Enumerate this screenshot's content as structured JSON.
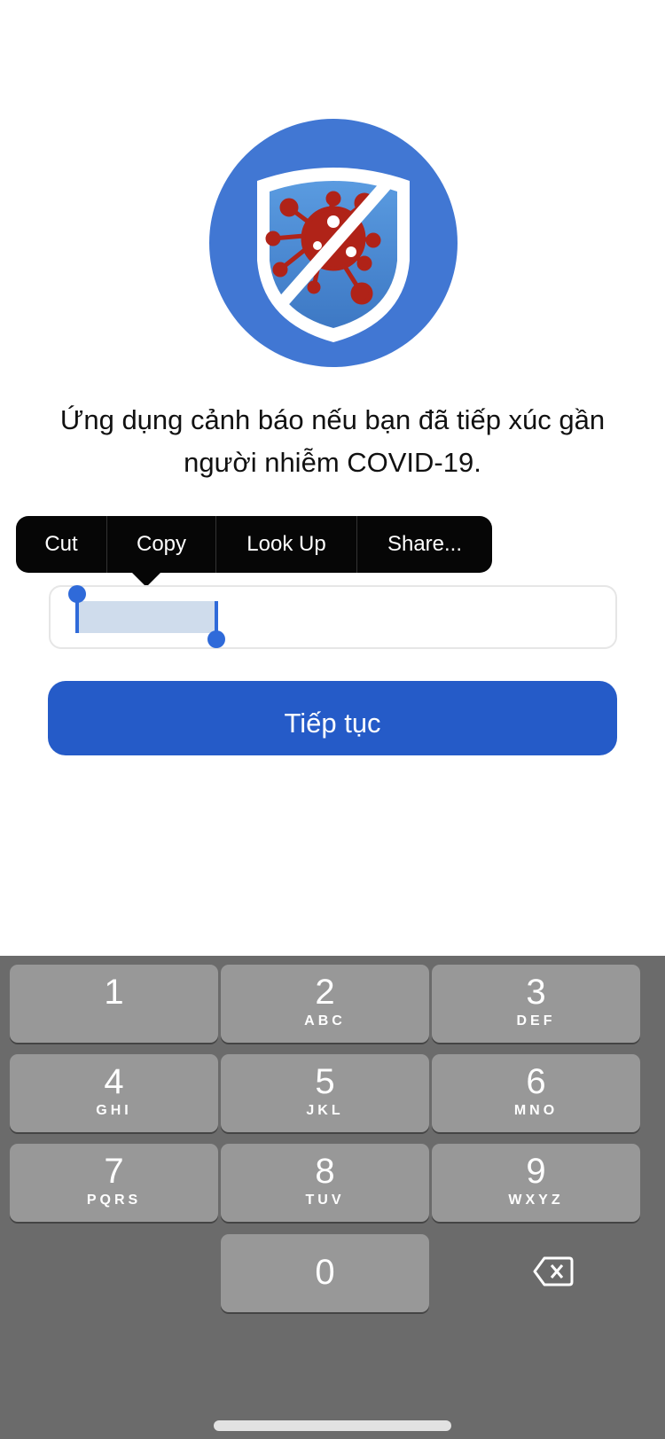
{
  "description": "Ứng dụng cảnh báo nếu bạn đã tiếp xúc gần người nhiễm COVID-19.",
  "context_menu": [
    "Cut",
    "Copy",
    "Look Up",
    "Share..."
  ],
  "phone_input": {
    "value": ""
  },
  "continue_label": "Tiếp tục",
  "colors": {
    "accent": "#255bc8",
    "logo_circle": "#4177d3",
    "virus": "#b02318",
    "keyboard_bg": "#6b6b6b",
    "key": "#989898"
  },
  "keypad": [
    {
      "digit": "1",
      "letters": ""
    },
    {
      "digit": "2",
      "letters": "ABC"
    },
    {
      "digit": "3",
      "letters": "DEF"
    },
    {
      "digit": "4",
      "letters": "GHI"
    },
    {
      "digit": "5",
      "letters": "JKL"
    },
    {
      "digit": "6",
      "letters": "MNO"
    },
    {
      "digit": "7",
      "letters": "PQRS"
    },
    {
      "digit": "8",
      "letters": "TUV"
    },
    {
      "digit": "9",
      "letters": "WXYZ"
    },
    {
      "digit": "0",
      "letters": ""
    }
  ],
  "icons": {
    "logo": "shield-virus-icon",
    "delete": "backspace-icon"
  }
}
